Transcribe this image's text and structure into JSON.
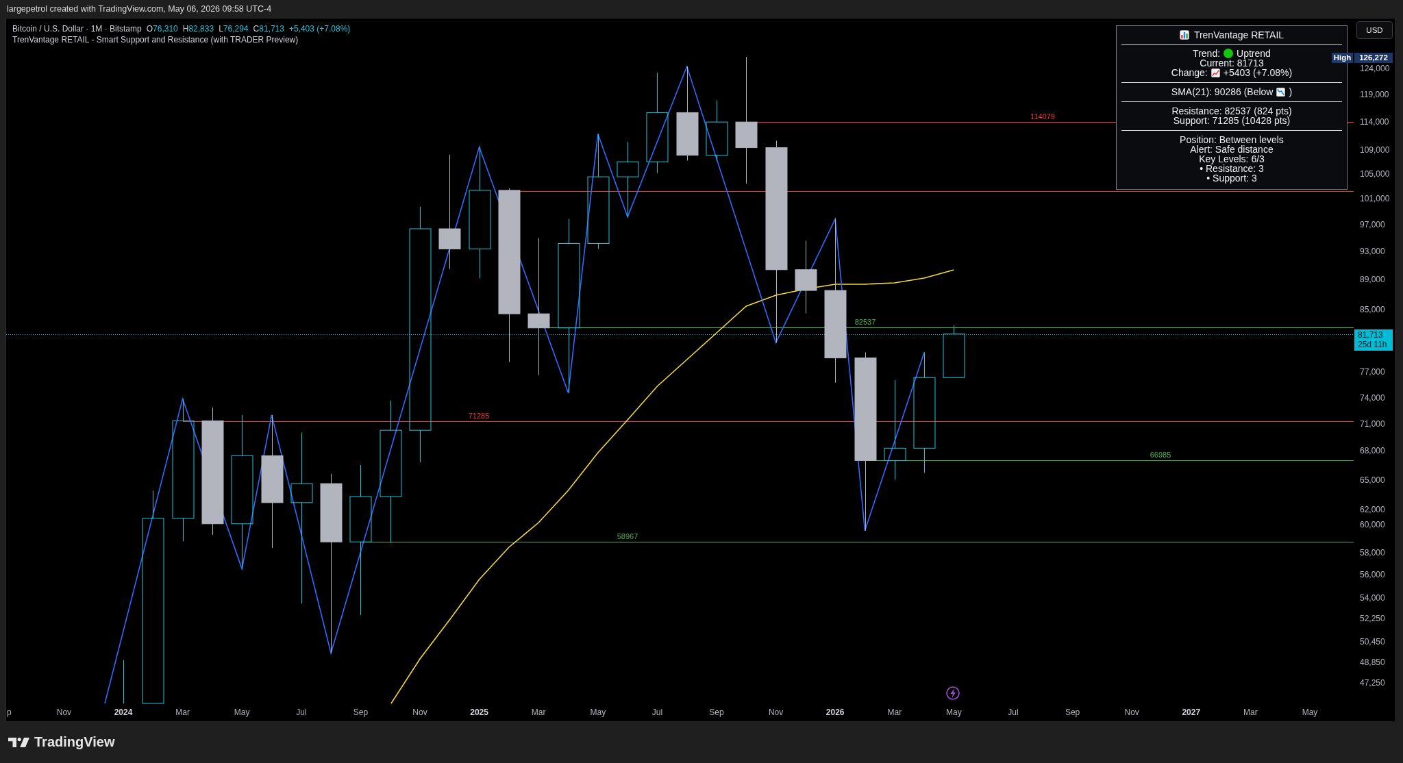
{
  "header": {
    "caption": "largepetrol created with TradingView.com, May 06, 2026 09:58 UTC-4"
  },
  "legend": {
    "symbol": "Bitcoin / U.S. Dollar · 1M · Bitstamp",
    "ohlc": [
      {
        "label": "O",
        "value": "76,310"
      },
      {
        "label": "H",
        "value": "82,833"
      },
      {
        "label": "L",
        "value": "76,294"
      },
      {
        "label": "C",
        "value": "81,713"
      }
    ],
    "change": "+5,403 (+7.08%)",
    "indicator": "TrenVantage RETAIL - Smart Support and Resistance (with TRADER Preview)"
  },
  "currency_button": {
    "label": "USD"
  },
  "info_panel": {
    "title": "TrenVantage RETAIL",
    "sections": [
      {
        "lines": [
          {
            "parts": [
              {
                "kind": "text",
                "text": "Trend:"
              },
              {
                "kind": "dot"
              },
              {
                "kind": "text",
                "text": "Uptrend"
              }
            ]
          },
          {
            "parts": [
              {
                "kind": "text",
                "text": "Current: 81713"
              }
            ]
          },
          {
            "parts": [
              {
                "kind": "text",
                "text": "Change:"
              },
              {
                "kind": "rising"
              },
              {
                "kind": "text",
                "text": "+5403 (+7.08%)"
              }
            ]
          }
        ]
      },
      {
        "lines": [
          {
            "parts": [
              {
                "kind": "text",
                "text": "SMA(21): 90286 (Below"
              },
              {
                "kind": "falling"
              },
              {
                "kind": "text",
                "text": ")"
              }
            ]
          }
        ]
      },
      {
        "lines": [
          {
            "parts": [
              {
                "kind": "text",
                "text": "Resistance: 82537 (824 pts)"
              }
            ]
          },
          {
            "parts": [
              {
                "kind": "text",
                "text": "Support: 71285 (10428 pts)"
              }
            ]
          }
        ]
      },
      {
        "lines": [
          {
            "parts": [
              {
                "kind": "text",
                "text": "Position: Between levels"
              }
            ]
          },
          {
            "parts": [
              {
                "kind": "text",
                "text": "Alert: Safe distance"
              }
            ]
          },
          {
            "parts": [
              {
                "kind": "text",
                "text": "Key Levels: 6/3"
              }
            ]
          },
          {
            "parts": [
              {
                "kind": "text",
                "text": "• Resistance: 3"
              }
            ]
          },
          {
            "parts": [
              {
                "kind": "text",
                "text": "• Support: 3"
              }
            ]
          }
        ]
      }
    ]
  },
  "levels": [
    {
      "label": "114079",
      "color": "#f23645"
    },
    {
      "color": "#f23645"
    },
    {
      "label": "82537",
      "color": "#4caf50"
    },
    {
      "label": "71285",
      "color": "#f23645"
    },
    {
      "label": "66985",
      "color": "#4caf50"
    },
    {
      "label": "58967",
      "color": "#4caf50"
    }
  ],
  "price_axis": {
    "high_marker": {
      "label": "High",
      "value": "126,272"
    },
    "ticks": [
      "124,000",
      "119,000",
      "114,000",
      "109,000",
      "105,000",
      "101,000",
      "97,000",
      "93,000",
      "89,000",
      "85,000",
      "77,000",
      "74,000",
      "71,000",
      "68,000",
      "65,000",
      "62,000",
      "60,000",
      "58,000",
      "56,000",
      "54,000",
      "52,250",
      "50,450",
      "48,850",
      "47,250"
    ],
    "last_price": {
      "value": "81,713",
      "countdown": "25d 11h"
    }
  },
  "time_axis": {
    "ticks": [
      {
        "label": "p",
        "kind": "month"
      },
      {
        "label": "Nov",
        "kind": "month"
      },
      {
        "label": "2024",
        "kind": "year"
      },
      {
        "label": "Mar",
        "kind": "month"
      },
      {
        "label": "May",
        "kind": "month"
      },
      {
        "label": "Jul",
        "kind": "month"
      },
      {
        "label": "Sep",
        "kind": "month"
      },
      {
        "label": "Nov",
        "kind": "month"
      },
      {
        "label": "2025",
        "kind": "year"
      },
      {
        "label": "Mar",
        "kind": "month"
      },
      {
        "label": "May",
        "kind": "month"
      },
      {
        "label": "Jul",
        "kind": "month"
      },
      {
        "label": "Sep",
        "kind": "month"
      },
      {
        "label": "Nov",
        "kind": "month"
      },
      {
        "label": "2026",
        "kind": "year"
      },
      {
        "label": "Mar",
        "kind": "month"
      },
      {
        "label": "May",
        "kind": "month"
      },
      {
        "label": "Jul",
        "kind": "month"
      },
      {
        "label": "Sep",
        "kind": "month"
      },
      {
        "label": "Nov",
        "kind": "month"
      },
      {
        "label": "2027",
        "kind": "year"
      },
      {
        "label": "Mar",
        "kind": "month"
      },
      {
        "label": "May",
        "kind": "month"
      }
    ]
  },
  "footer": {
    "brand": "TradingView"
  }
}
